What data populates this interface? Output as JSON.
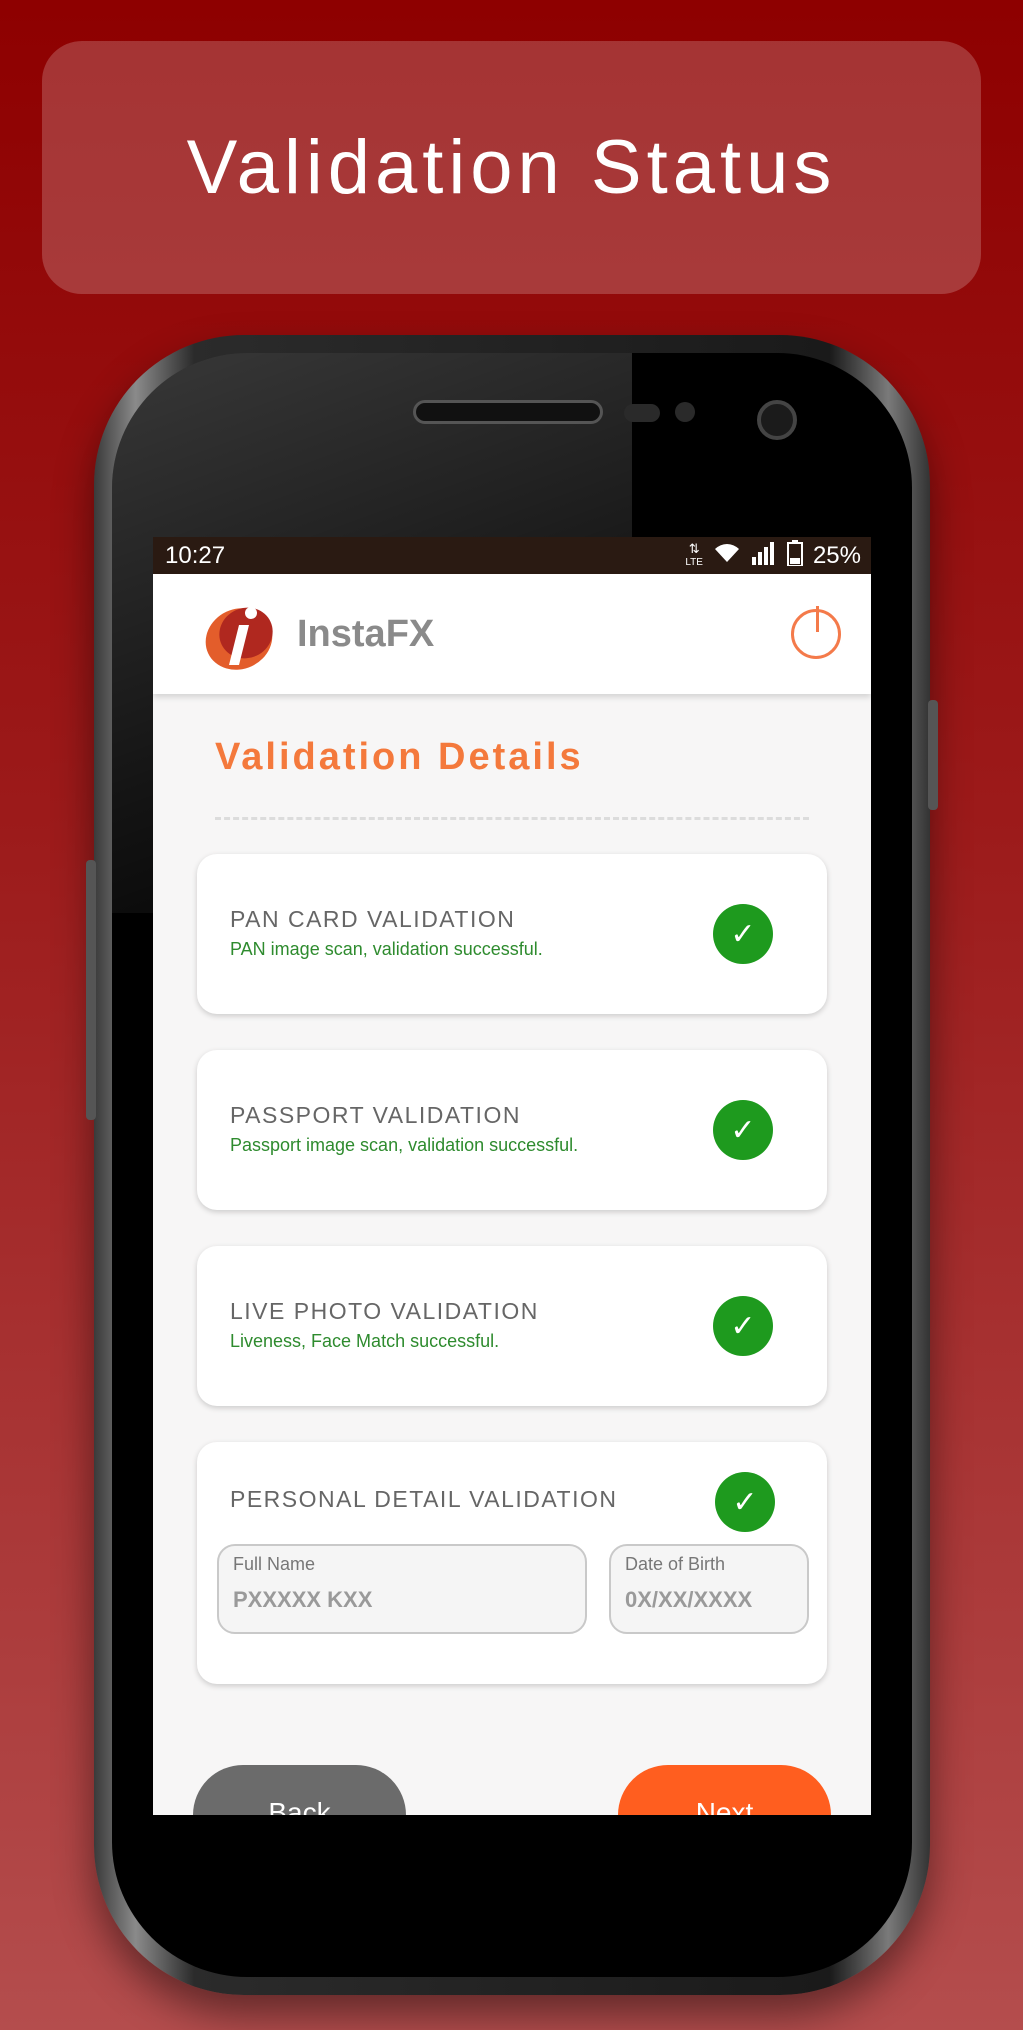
{
  "banner": {
    "title": "Validation Status"
  },
  "statusbar": {
    "time": "10:27",
    "network": "LTE",
    "battery": "25%"
  },
  "app": {
    "name": "InstaFX"
  },
  "section": {
    "title": "Validation Details"
  },
  "cards": [
    {
      "title": "PAN CARD VALIDATION",
      "subtitle": "PAN image scan, validation successful.",
      "status": "success"
    },
    {
      "title": "PASSPORT VALIDATION",
      "subtitle": "Passport image scan, validation successful.",
      "status": "success"
    },
    {
      "title": "LIVE PHOTO VALIDATION",
      "subtitle": "Liveness, Face Match successful.",
      "status": "success"
    },
    {
      "title": "PERSONAL DETAIL VALIDATION",
      "status": "success"
    }
  ],
  "personal": {
    "full_name_label": "Full Name",
    "full_name_value": "PXXXXX KXX",
    "dob_label": "Date of Birth",
    "dob_value": "0X/XX/XXXX"
  },
  "buttons": {
    "back": "Back",
    "next": "Next"
  },
  "colors": {
    "accent": "#f4793c",
    "success": "#1e9a1e",
    "next_button": "#ff5e1f",
    "back_button": "#6b6b6b"
  }
}
